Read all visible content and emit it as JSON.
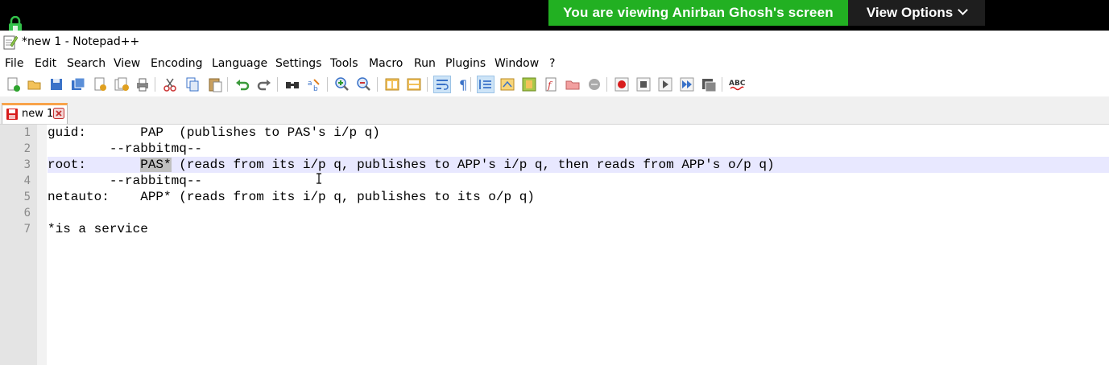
{
  "share_banner": {
    "message": "You are viewing Anirban Ghosh's screen",
    "view_options_label": "View Options",
    "colors": {
      "message_bg": "#22b022",
      "bar_bg": "#000000"
    }
  },
  "window": {
    "title": "*new 1 - Notepad++",
    "icon": "notepadpp-icon"
  },
  "menu": {
    "items": [
      {
        "label": "File",
        "key": "F"
      },
      {
        "label": "Edit",
        "key": "E"
      },
      {
        "label": "Search",
        "key": "S"
      },
      {
        "label": "View",
        "key": "V"
      },
      {
        "label": "Encoding",
        "key": "n"
      },
      {
        "label": "Language",
        "key": "L"
      },
      {
        "label": "Settings",
        "key": "t"
      },
      {
        "label": "Tools",
        "key": "o"
      },
      {
        "label": "Macro",
        "key": "M"
      },
      {
        "label": "Run",
        "key": "R"
      },
      {
        "label": "Plugins",
        "key": "P"
      },
      {
        "label": "Window",
        "key": "W"
      },
      {
        "label": "?",
        "key": "?"
      }
    ]
  },
  "toolbar": {
    "icons": [
      "new-file-icon",
      "open-file-icon",
      "save-icon",
      "save-all-icon",
      "close-icon",
      "close-all-icon",
      "print-icon",
      "cut-icon",
      "copy-icon",
      "paste-icon",
      "undo-icon",
      "redo-icon",
      "find-icon",
      "replace-icon",
      "zoom-in-icon",
      "zoom-out-icon",
      "sync-vertical-icon",
      "sync-horizontal-icon",
      "word-wrap-icon",
      "show-all-chars-icon",
      "indent-guide-icon",
      "user-language-icon",
      "doc-map-icon",
      "function-list-icon",
      "folder-workspace-icon",
      "monitoring-icon",
      "record-macro-icon",
      "stop-macro-icon",
      "play-macro-icon",
      "run-macro-multiple-icon",
      "save-macro-icon",
      "spell-check-icon"
    ]
  },
  "tabs": [
    {
      "label": "new 1",
      "modified": true,
      "active": true
    }
  ],
  "editor": {
    "lines": [
      {
        "num": "1",
        "pre": "guid:       PAP  (publishes to PAS's i/p q)",
        "sel": "",
        "post": ""
      },
      {
        "num": "2",
        "pre": "        --rabbitmq--",
        "sel": "",
        "post": ""
      },
      {
        "num": "3",
        "pre": "root:       ",
        "sel": "PAS*",
        "post": " (reads from its i/p q, publishes to APP's i/p q, then reads from APP's o/p q)"
      },
      {
        "num": "4",
        "pre": "        --rabbitmq--",
        "sel": "",
        "post": ""
      },
      {
        "num": "5",
        "pre": "netauto:    APP* (reads from its i/p q, publishes to its o/p q)",
        "sel": "",
        "post": ""
      },
      {
        "num": "6",
        "pre": "",
        "sel": "",
        "post": ""
      },
      {
        "num": "7",
        "pre": "*is a service",
        "sel": "",
        "post": ""
      }
    ],
    "current_line": 3
  }
}
